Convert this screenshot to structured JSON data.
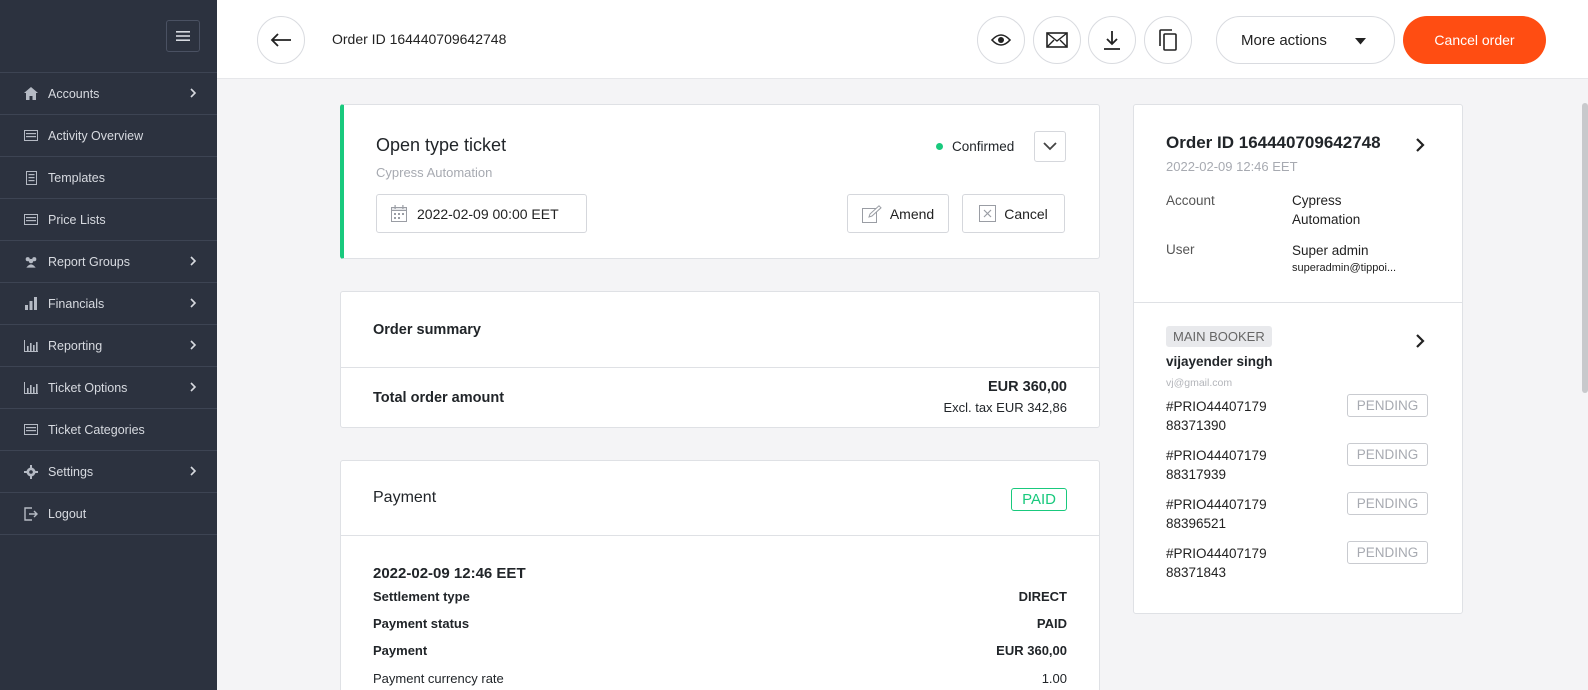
{
  "sidebar": {
    "items": [
      {
        "label": "Accounts",
        "icon": "home-icon",
        "has_children": true
      },
      {
        "label": "Activity Overview",
        "icon": "list-icon",
        "has_children": false
      },
      {
        "label": "Templates",
        "icon": "document-icon",
        "has_children": false
      },
      {
        "label": "Price Lists",
        "icon": "list-icon",
        "has_children": false
      },
      {
        "label": "Report Groups",
        "icon": "users-icon",
        "has_children": true
      },
      {
        "label": "Financials",
        "icon": "bar-chart-icon",
        "has_children": true
      },
      {
        "label": "Reporting",
        "icon": "bar-chart-icon",
        "has_children": true
      },
      {
        "label": "Ticket Options",
        "icon": "bar-chart-icon",
        "has_children": true
      },
      {
        "label": "Ticket Categories",
        "icon": "list-icon",
        "has_children": false
      },
      {
        "label": "Settings",
        "icon": "gear-icon",
        "has_children": true
      },
      {
        "label": "Logout",
        "icon": "logout-icon",
        "has_children": false
      }
    ]
  },
  "header": {
    "title": "Order ID 164440709642748",
    "more_actions_label": "More actions",
    "cancel_order_label": "Cancel order"
  },
  "ticket": {
    "title": "Open type ticket",
    "subtitle": "Cypress Automation",
    "status": "Confirmed",
    "date": "2022-02-09 00:00 EET",
    "amend_label": "Amend",
    "cancel_label": "Cancel"
  },
  "summary": {
    "heading": "Order summary",
    "total_label": "Total order amount",
    "total_amount": "EUR 360,00",
    "total_excl_tax": "Excl. tax EUR 342,86"
  },
  "payment": {
    "heading": "Payment",
    "badge": "PAID",
    "date": "2022-02-09 12:46 EET",
    "rows": [
      {
        "label": "Settlement type",
        "value": "DIRECT"
      },
      {
        "label": "Payment status",
        "value": "PAID"
      },
      {
        "label": "Payment",
        "value": "EUR 360,00"
      },
      {
        "label": "Payment currency rate",
        "value": "1.00"
      }
    ]
  },
  "order_panel": {
    "title": "Order ID 164440709642748",
    "date": "2022-02-09 12:46 EET",
    "account_label": "Account",
    "account_value": "Cypress Automation",
    "user_label": "User",
    "user_value": "Super admin",
    "user_email": "superadmin@tippoi..."
  },
  "booker": {
    "badge": "MAIN BOOKER",
    "name": "vijayender singh",
    "email": "vj@gmail.com",
    "tickets": [
      {
        "id": "#PRIO44407179 88371390",
        "status": "PENDING"
      },
      {
        "id": "#PRIO44407179 88317939",
        "status": "PENDING"
      },
      {
        "id": "#PRIO44407179 88396521",
        "status": "PENDING"
      },
      {
        "id": "#PRIO44407179 88371843",
        "status": "PENDING"
      }
    ]
  },
  "colors": {
    "sidebar_bg": "#2c323f",
    "accent": "#ff4d12",
    "success": "#19c97d"
  }
}
